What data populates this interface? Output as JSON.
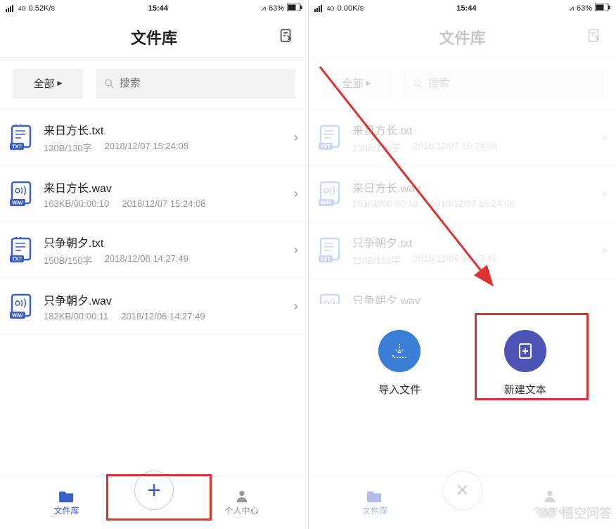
{
  "status": {
    "network_left": "0.52K/s",
    "network_right": "0.00K/s",
    "signal_label": "4G",
    "time": "15:44",
    "battery": "63%",
    "bell": "⩘"
  },
  "header": {
    "title": "文件库"
  },
  "filter": {
    "all_label": "全部",
    "search_placeholder": "搜索"
  },
  "files": [
    {
      "icon": "txt",
      "name": "来日方长.txt",
      "meta1": "130B/130字",
      "meta2": "2018/12/07 15:24:08"
    },
    {
      "icon": "wav",
      "name": "来日方长.wav",
      "meta1": "163KB/00:00:10",
      "meta2": "2018/12/07 15:24:08"
    },
    {
      "icon": "txt",
      "name": "只争朝夕.txt",
      "meta1": "150B/150字",
      "meta2": "2018/12/06 14:27:49"
    },
    {
      "icon": "wav",
      "name": "只争朝夕.wav",
      "meta1": "182KB/00:00:11",
      "meta2": "2018/12/06 14:27:49"
    }
  ],
  "nav": {
    "file_lib": "文件库",
    "profile": "个人中心"
  },
  "popup": {
    "import_label": "导入文件",
    "new_text_label": "新建文本"
  },
  "watermark": "悟空问答"
}
